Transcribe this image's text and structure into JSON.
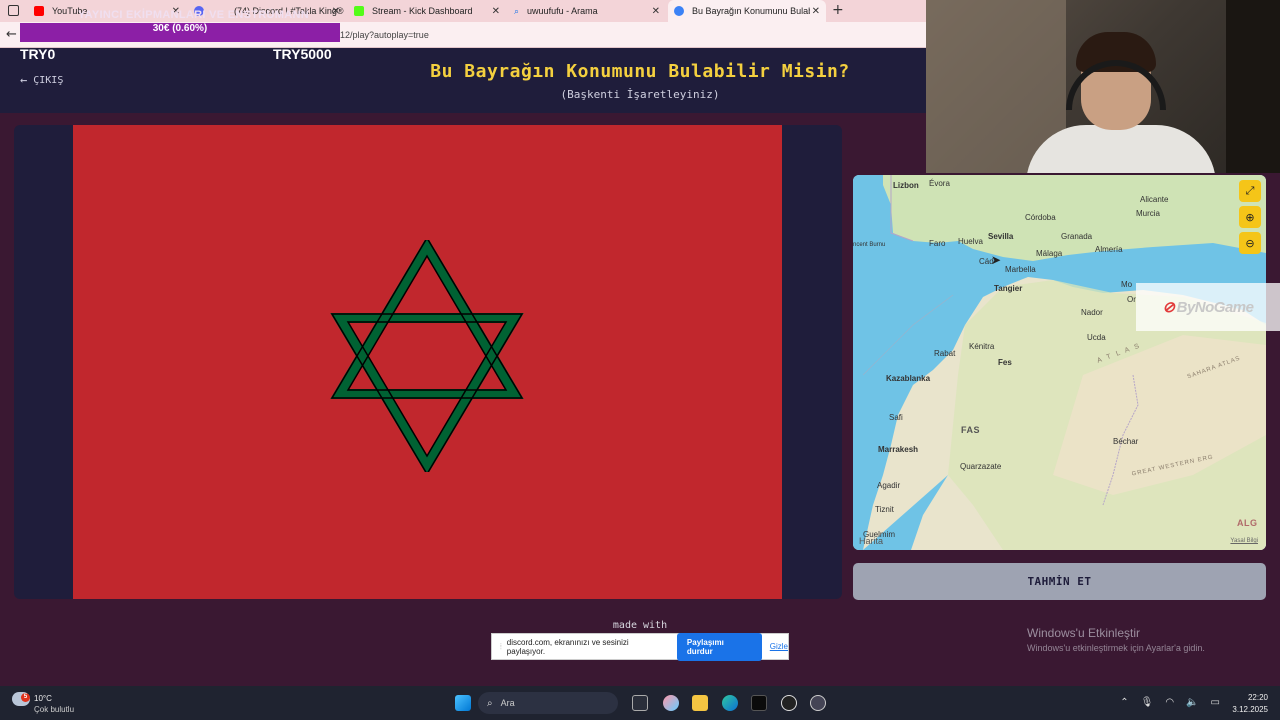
{
  "browser": {
    "tabs": [
      {
        "label": "YouTube",
        "color": "#ff0000"
      },
      {
        "label": "(74) Discord | #Takla King®",
        "color": "#5865f2"
      },
      {
        "label": "Stream - Kick Dashboard",
        "color": "#53fc18"
      },
      {
        "label": "uwuufufu - Arama",
        "color": "#1a73e8"
      },
      {
        "label": "Bu Bayrağın Konumunu Bulabilir M",
        "color": "#3b82f6"
      }
    ],
    "new_tab": "+",
    "url": "12/play?autoplay=true"
  },
  "goal": {
    "title": "YAYINCI EKİPMANLARI VE ENSTRÜMANN",
    "progress_text": "30€ (0.60%)",
    "progress": 0.006
  },
  "game": {
    "try_left": "TRY0",
    "try_right": "TRY5000",
    "exit_label": "ÇIKIŞ",
    "title": "Bu Bayrağın Konumunu Bulabilir Misin?",
    "subtitle": "(Başkenti İşaretleyiniz)",
    "guess_button": "TAHMİN ET",
    "footer": "made with",
    "flag_colors": {
      "field": "#c1272d",
      "star": "#006233"
    }
  },
  "map": {
    "labels": {
      "lizbon": "Lizbon",
      "evora": "Évora",
      "cordoba": "Córdoba",
      "alicante": "Alicante",
      "murcia": "Murcia",
      "sevilla": "Sevilla",
      "granada": "Granada",
      "faro": "Faro",
      "huelva": "Huelva",
      "malaga": "Málaga",
      "almeria": "Almería",
      "cadiz": "Cád",
      "marbella": "Marbella",
      "tangier": "Tangier",
      "nador": "Nador",
      "ucda": "Ucda",
      "kenitra": "Kénitra",
      "rabat": "Rabat",
      "fes": "Fes",
      "kazablanka": "Kazablanka",
      "safi": "Safi",
      "fas": "FAS",
      "marrakesh": "Marrakesh",
      "bechar": "Béchar",
      "quarzazate": "Quarzazate",
      "agadir": "Agadir",
      "tiznit": "Tiznit",
      "guelmim": "Guelmim",
      "cape": "ncent Burnu",
      "atlas": "A T L A S",
      "sahara_atlas": "SAHARA ATLAS",
      "erg": "GREAT WESTERN ERG",
      "alg": "ALG",
      "mo": "Mo",
      "or": "Or"
    },
    "brand": "Harita",
    "legal": "Yasal Bilgi",
    "buttons": {
      "expand": "⤢",
      "zoom_in": "⊕",
      "zoom_out": "⊖"
    }
  },
  "watermark": "ByNoGame",
  "windows_activation": {
    "title": "Windows'u Etkinleştir",
    "subtitle": "Windows'u etkinleştirmek için Ayarlar'a gidin."
  },
  "share_bar": {
    "text": "discord.com, ekranınızı ve sesinizi paylaşıyor.",
    "stop": "Paylaşımı durdur",
    "hide": "Gizle"
  },
  "taskbar": {
    "weather_badge": "5",
    "temperature": "10°C",
    "condition": "Çok bulutlu",
    "search": "Ara",
    "time": "22:20",
    "date": "3.12.2025"
  }
}
